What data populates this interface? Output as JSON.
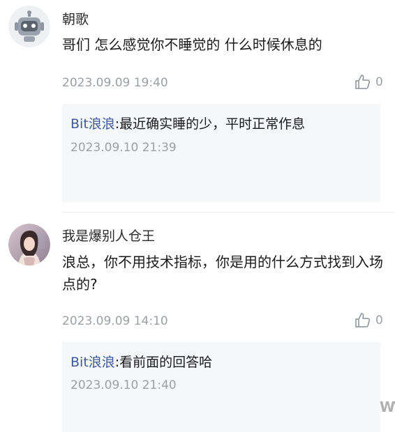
{
  "comments": [
    {
      "username": "朝歌",
      "text": "哥们 怎么感觉你不睡觉的 什么时候休息的",
      "timestamp": "2023.09.09 19:40",
      "likes": "0",
      "reply": {
        "user": "Bit浪浪",
        "separator": ":",
        "text": "最近确实睡的少，平时正常作息",
        "timestamp": "2023.09.10 21:39"
      }
    },
    {
      "username": "我是爆别人仓王",
      "text": "浪总，你不用技术指标，你是用的什么方式找到入场点的?",
      "timestamp": "2023.09.09 14:10",
      "likes": "0",
      "reply": {
        "user": "Bit浪浪",
        "separator": ":",
        "text": "看前面的回答哈",
        "timestamp": "2023.09.10 21:40"
      }
    }
  ],
  "watermark": "WV",
  "colors": {
    "link": "#3d5a98",
    "meta": "#9aa0a6",
    "reply_bg": "#f6f7f9"
  },
  "icons": {
    "like": "thumbs-up-icon",
    "avatar1": "robot-avatar",
    "avatar2": "user-photo-avatar"
  }
}
